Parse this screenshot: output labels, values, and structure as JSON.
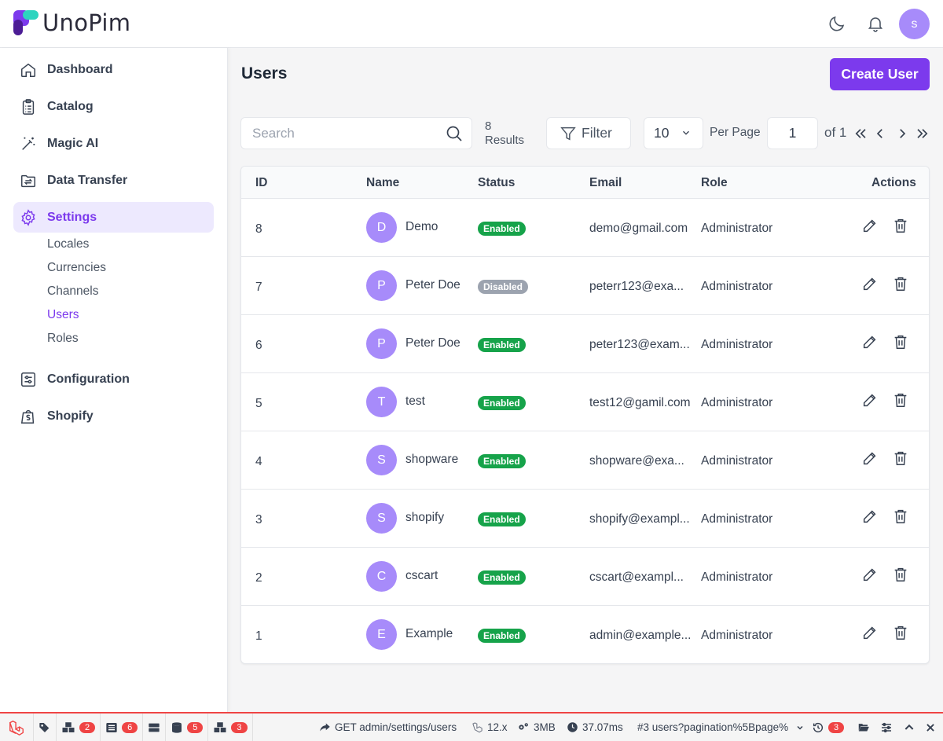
{
  "app": {
    "logo_text": "UnoPim",
    "avatar_initial": "s"
  },
  "sidebar": {
    "items": [
      {
        "label": "Dashboard",
        "icon": "home-icon"
      },
      {
        "label": "Catalog",
        "icon": "clipboard-icon"
      },
      {
        "label": "Magic AI",
        "icon": "magic-wand-icon"
      },
      {
        "label": "Data Transfer",
        "icon": "folder-transfer-icon"
      },
      {
        "label": "Settings",
        "icon": "gear-icon",
        "active": true
      },
      {
        "label": "Configuration",
        "icon": "sliders-icon"
      },
      {
        "label": "Shopify",
        "icon": "shopping-bag-icon"
      }
    ],
    "sub_items": [
      "Locales",
      "Currencies",
      "Channels",
      "Users",
      "Roles"
    ],
    "active_sub": "Users"
  },
  "page": {
    "title": "Users",
    "create_label": "Create User"
  },
  "toolbar": {
    "search_placeholder": "Search",
    "results_count": "8",
    "results_label": "Results",
    "filter_label": "Filter",
    "per_page_value": "10",
    "per_page_label": "Per Page",
    "page_value": "1",
    "of_label": "of 1"
  },
  "table": {
    "headers": {
      "id": "ID",
      "name": "Name",
      "status": "Status",
      "email": "Email",
      "role": "Role",
      "actions": "Actions"
    },
    "rows": [
      {
        "id": "8",
        "initial": "D",
        "name": "Demo",
        "status": "Enabled",
        "email": "demo@gmail.com",
        "role": "Administrator"
      },
      {
        "id": "7",
        "initial": "P",
        "name": "Peter Doe",
        "status": "Disabled",
        "email": "peterr123@exa...",
        "role": "Administrator"
      },
      {
        "id": "6",
        "initial": "P",
        "name": "Peter Doe",
        "status": "Enabled",
        "email": "peter123@exam...",
        "role": "Administrator"
      },
      {
        "id": "5",
        "initial": "T",
        "name": "test",
        "status": "Enabled",
        "email": "test12@gamil.com",
        "role": "Administrator"
      },
      {
        "id": "4",
        "initial": "S",
        "name": "shopware",
        "status": "Enabled",
        "email": "shopware@exa...",
        "role": "Administrator"
      },
      {
        "id": "3",
        "initial": "S",
        "name": "shopify",
        "status": "Enabled",
        "email": "shopify@exampl...",
        "role": "Administrator"
      },
      {
        "id": "2",
        "initial": "C",
        "name": "cscart",
        "status": "Enabled",
        "email": "cscart@exampl...",
        "role": "Administrator"
      },
      {
        "id": "1",
        "initial": "E",
        "name": "Example",
        "status": "Enabled",
        "email": "admin@example...",
        "role": "Administrator"
      }
    ]
  },
  "debugbar": {
    "counts": [
      "2",
      "6",
      "5",
      "3"
    ],
    "request": "GET admin/settings/users",
    "version": "12.x",
    "memory": "3MB",
    "time": "37.07ms",
    "route": "#3 users?pagination%5Bpage%",
    "history_count": "3"
  },
  "colors": {
    "accent": "#7c3aed",
    "enabled": "#16a34a",
    "disabled": "#9ca3af",
    "avatar": "#a78bfa",
    "debug_red": "#ef4444"
  }
}
